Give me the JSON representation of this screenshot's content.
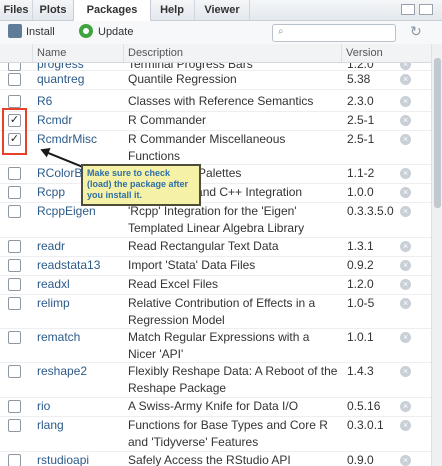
{
  "tabs": [
    {
      "label": "Files",
      "active": false
    },
    {
      "label": "Plots",
      "active": false
    },
    {
      "label": "Packages",
      "active": true
    },
    {
      "label": "Help",
      "active": false
    },
    {
      "label": "Viewer",
      "active": false
    }
  ],
  "toolbar": {
    "install_label": "Install",
    "update_label": "Update",
    "search_placeholder": ""
  },
  "columns": {
    "name": "Name",
    "description": "Description",
    "version": "Version"
  },
  "packages": [
    {
      "name": "progress",
      "description": "Terminal Progress Bars",
      "version": "1.2.0",
      "checked": false
    },
    {
      "name": "quantreg",
      "description": "Quantile Regression",
      "version": "5.38",
      "checked": false
    },
    {
      "name": "R6",
      "description": "Classes with Reference Semantics",
      "version": "2.3.0",
      "checked": false
    },
    {
      "name": "Rcmdr",
      "description": "R Commander",
      "version": "2.5-1",
      "checked": true
    },
    {
      "name": "RcmdrMisc",
      "description": "R Commander Miscellaneous Functions",
      "version": "2.5-1",
      "checked": true
    },
    {
      "name": "RColorBrewer",
      "description": "ColorBrewer Palettes",
      "version": "1.1-2",
      "checked": false
    },
    {
      "name": "Rcpp",
      "description": "Seamless R and C++ Integration",
      "version": "1.0.0",
      "checked": false
    },
    {
      "name": "RcppEigen",
      "description": "'Rcpp' Integration for the 'Eigen' Templated Linear Algebra Library",
      "version": "0.3.3.5.0",
      "checked": false
    },
    {
      "name": "readr",
      "description": "Read Rectangular Text Data",
      "version": "1.3.1",
      "checked": false
    },
    {
      "name": "readstata13",
      "description": "Import 'Stata' Data Files",
      "version": "0.9.2",
      "checked": false
    },
    {
      "name": "readxl",
      "description": "Read Excel Files",
      "version": "1.2.0",
      "checked": false
    },
    {
      "name": "relimp",
      "description": "Relative Contribution of Effects in a Regression Model",
      "version": "1.0-5",
      "checked": false
    },
    {
      "name": "rematch",
      "description": "Match Regular Expressions with a Nicer 'API'",
      "version": "1.0.1",
      "checked": false
    },
    {
      "name": "reshape2",
      "description": "Flexibly Reshape Data: A Reboot of the Reshape Package",
      "version": "1.4.3",
      "checked": false
    },
    {
      "name": "rio",
      "description": "A Swiss-Army Knife for Data I/O",
      "version": "0.5.16",
      "checked": false
    },
    {
      "name": "rlang",
      "description": "Functions for Base Types and Core R and 'Tidyverse' Features",
      "version": "0.3.0.1",
      "checked": false
    },
    {
      "name": "rstudioapi",
      "description": "Safely Access the RStudio API",
      "version": "0.9.0",
      "checked": false
    }
  ],
  "callout": {
    "text": "Make sure to check (load) the package after you install it."
  },
  "colors": {
    "accent": "#e8412a",
    "callout_bg": "#f5f1a6",
    "link": "#2c5a8a"
  }
}
